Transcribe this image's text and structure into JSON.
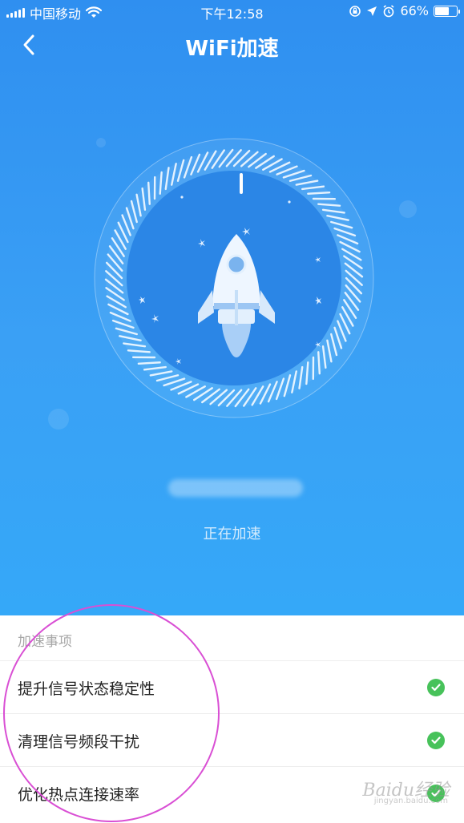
{
  "status_bar": {
    "carrier": "中国移动",
    "time": "下午12:58",
    "battery": "66%",
    "battery_level": 0.66
  },
  "nav": {
    "title": "WiFi加速",
    "back_icon": "chevron-left-icon"
  },
  "accelerator": {
    "status": "正在加速",
    "rocket_icon": "rocket-icon"
  },
  "list": {
    "header": "加速事项",
    "items": [
      {
        "label": "提升信号状态稳定性",
        "status_icon": "check-icon"
      },
      {
        "label": "清理信号频段干扰",
        "status_icon": "check-icon"
      },
      {
        "label": "优化热点连接速率",
        "status_icon": "check-icon"
      }
    ]
  },
  "watermark": {
    "text": "Baidu经验",
    "sub": "jingyan.baidu.com"
  },
  "colors": {
    "hero_top": "#2f8ff0",
    "hero_bottom": "#35a8f8",
    "check_green": "#47c25a",
    "annotation": "#d94fd4"
  }
}
